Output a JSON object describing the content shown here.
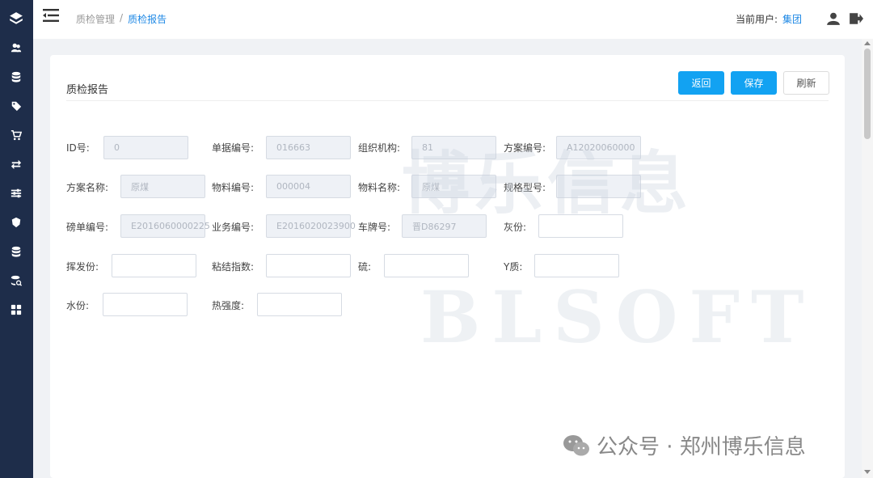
{
  "header": {
    "breadcrumb": [
      "质检管理",
      "/",
      "质检报告"
    ],
    "current_user_label": "当前用户:",
    "current_user": "集团"
  },
  "card": {
    "title": "质检报告",
    "buttons": {
      "back": "返回",
      "save": "保存",
      "refresh": "刷新"
    }
  },
  "form": {
    "id_label": "ID号:",
    "id_value": "0",
    "doc_no_label": "单据编号:",
    "doc_no_value": "016663",
    "org_label": "组织机构:",
    "org_value": "81",
    "plan_no_label": "方案编号:",
    "plan_no_value": "A12020060000",
    "plan_name_label": "方案名称:",
    "plan_name_value": "原煤",
    "material_no_label": "物料编号:",
    "material_no_value": "000004",
    "material_name_label": "物料名称:",
    "material_name_value": "原煤",
    "spec_label": "规格型号:",
    "spec_value": "",
    "weigh_no_label": "磅单编号:",
    "weigh_no_value": "E2016060000225",
    "biz_no_label": "业务编号:",
    "biz_no_value": "E2016020023900",
    "plate_label": "车牌号:",
    "plate_value": "晋D86297",
    "ash_label": "灰份:",
    "ash_value": "",
    "volatile_label": "挥发份:",
    "volatile_value": "",
    "caking_label": "粘结指数:",
    "caking_value": "",
    "sulfur_label": "硫:",
    "sulfur_value": "",
    "y_label": "Y质:",
    "y_value": "",
    "moisture_label": "水份:",
    "moisture_value": "",
    "hot_strength_label": "热强度:",
    "hot_strength_value": ""
  },
  "watermark": {
    "cn": "博乐信息",
    "en": "BLSOFT"
  },
  "footer_mark": "公众号 · 郑州博乐信息"
}
